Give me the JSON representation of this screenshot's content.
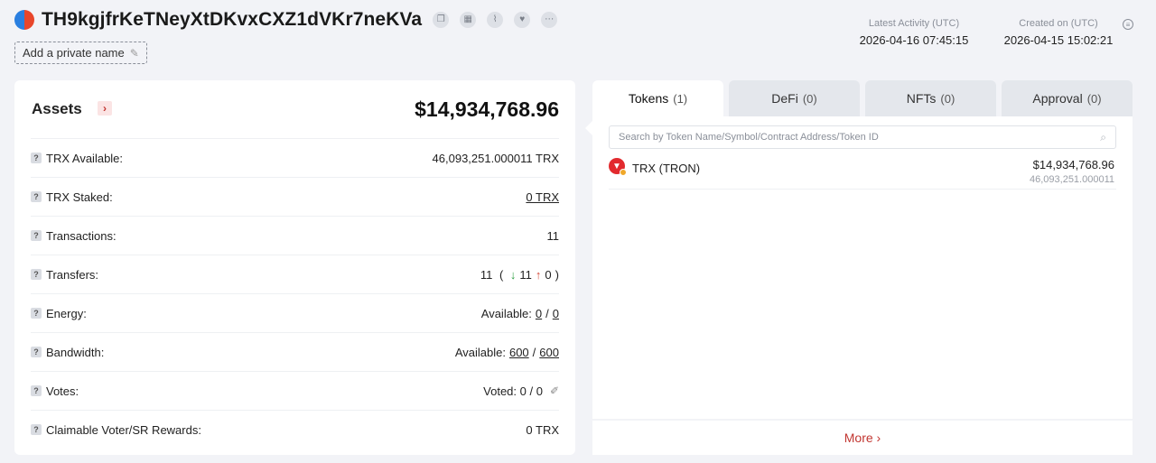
{
  "header": {
    "address": "TH9kgjfrKeTNeyXtDKvxCXZ1dVKr7neKVa",
    "private_name_label": "Add a private name",
    "latest_activity_label": "Latest Activity (UTC)",
    "latest_activity_value": "2026-04-16 07:45:15",
    "created_on_label": "Created on (UTC)",
    "created_on_value": "2026-04-15 15:02:21"
  },
  "assets": {
    "title": "Assets",
    "total": "$14,934,768.96",
    "rows": [
      {
        "label": "TRX Available:",
        "value": "46,093,251.000011 TRX"
      },
      {
        "label": "TRX Staked:",
        "value": "0 TRX"
      },
      {
        "label": "Transactions:",
        "value": "11"
      },
      {
        "label": "Transfers:",
        "total": "11",
        "in": "11",
        "out": "0"
      },
      {
        "label": "Energy:",
        "prefix": "Available:",
        "a": "0",
        "b": "0"
      },
      {
        "label": "Bandwidth:",
        "prefix": "Available:",
        "a": "600",
        "b": "600"
      },
      {
        "label": "Votes:",
        "value": "Voted: 0 / 0"
      },
      {
        "label": "Claimable Voter/SR Rewards:",
        "value": "0 TRX"
      }
    ]
  },
  "tabs": [
    {
      "label": "Tokens",
      "count": "(1)"
    },
    {
      "label": "DeFi",
      "count": "(0)"
    },
    {
      "label": "NFTs",
      "count": "(0)"
    },
    {
      "label": "Approval",
      "count": "(0)"
    }
  ],
  "tokens": {
    "search_placeholder": "Search by Token Name/Symbol/Contract Address/Token ID",
    "items": [
      {
        "name": "TRX (TRON)",
        "usd": "$14,934,768.96",
        "amount": "46,093,251.000011"
      }
    ],
    "more_label": "More"
  },
  "colors": {
    "accent": "#c23631",
    "green": "#2ea043",
    "background": "#f2f3f7"
  }
}
